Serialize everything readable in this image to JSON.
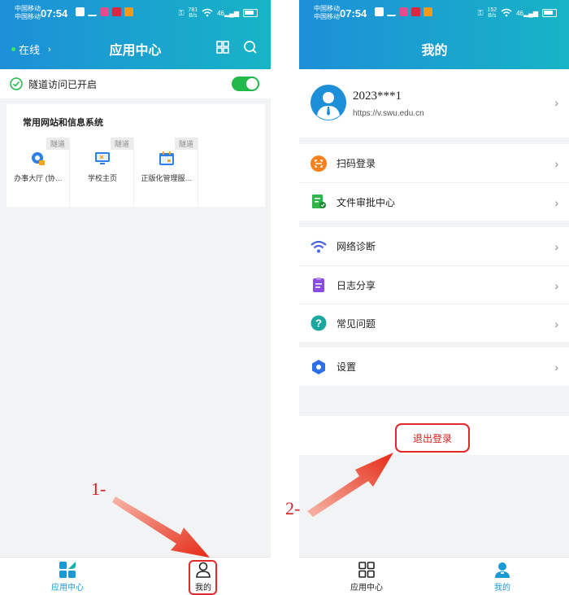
{
  "status_bar": {
    "left": {
      "carrier_line1": "中国移动",
      "carrier_line2": "中国移动",
      "time": "07:54",
      "speed_value": "781",
      "speed_unit": "B/s",
      "network": "46"
    },
    "right": {
      "carrier_line1": "中国移动",
      "carrier_line2": "中国移动",
      "time": "07:54",
      "speed_value": "152",
      "speed_unit": "B/s",
      "network": "46"
    }
  },
  "app_center": {
    "status": "在线",
    "title": "应用中心",
    "tunnel_text": "隧道访问已开启",
    "tunnel_enabled": true,
    "section_title": "常用网站和信息系统",
    "tiles": [
      {
        "label": "办事大厅 (协…",
        "tag": "隧道",
        "icon": "service-hall-icon"
      },
      {
        "label": "学校主页",
        "tag": "隧道",
        "icon": "monitor-icon"
      },
      {
        "label": "正版化管理服…",
        "tag": "隧道",
        "icon": "calendar-icon"
      }
    ]
  },
  "mine": {
    "title": "我的",
    "user_id": "2023***1",
    "user_url": "https://v.swu.edu.cn",
    "group1": [
      {
        "label": "扫码登录",
        "icon": "scan-login-icon"
      },
      {
        "label": "文件审批中心",
        "icon": "file-approval-icon"
      }
    ],
    "group2": [
      {
        "label": "网络诊断",
        "icon": "wifi-icon"
      },
      {
        "label": "日志分享",
        "icon": "clipboard-icon"
      },
      {
        "label": "常见问题",
        "icon": "question-icon"
      }
    ],
    "group3": [
      {
        "label": "设置",
        "icon": "settings-hexagon-icon"
      }
    ],
    "logout": "退出登录"
  },
  "tabbar": {
    "app_center": "应用中心",
    "mine": "我的"
  },
  "annotations": {
    "step1": "1-",
    "step2": "2-"
  },
  "colors": {
    "header_start": "#1d8fd8",
    "header_end": "#17b4c6",
    "accent": "#1a9ad4",
    "toggle_on": "#22b84a",
    "annotation_red": "#e12b2b"
  }
}
